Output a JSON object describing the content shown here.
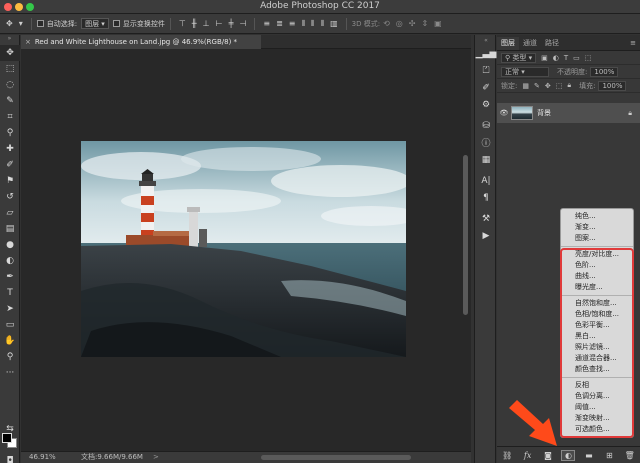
{
  "window": {
    "title": "Adobe Photoshop CC 2017"
  },
  "options_bar": {
    "auto_select_label": "自动选择:",
    "auto_select_value": "图层",
    "show_transform_label": "显示变换控件",
    "mode_3d_label": "3D 模式:"
  },
  "document": {
    "tab_title": "Red and White Lighthouse on Land.jpg @ 46.9%(RGB/8) *",
    "close_glyph": "×"
  },
  "status_bar": {
    "zoom": "46.91%",
    "doc_info": "文档:9.66M/9.66M",
    "arrow": ">"
  },
  "layers_panel": {
    "tabs": [
      "图层",
      "通道",
      "路径"
    ],
    "filter_kind": "类型",
    "blend_mode": "正常",
    "opacity_label": "不透明度:",
    "opacity_value": "100%",
    "lock_label": "锁定:",
    "fill_label": "填充:",
    "fill_value": "100%",
    "layer_name": "背景"
  },
  "adjustment_menu": {
    "group1": [
      "纯色...",
      "渐变...",
      "图案..."
    ],
    "group2": [
      "亮度/对比度...",
      "色阶...",
      "曲线...",
      "曝光度..."
    ],
    "group3": [
      "自然饱和度...",
      "色相/饱和度...",
      "色彩平衡...",
      "黑白...",
      "照片滤镜...",
      "通道混合器...",
      "颜色查找..."
    ],
    "group4": [
      "反相",
      "色调分离...",
      "阈值...",
      "渐变映射...",
      "可选颜色..."
    ]
  },
  "colors": {
    "highlight_border": "#e03a3a",
    "arrow": "#ff4a1a",
    "foreground_swatch": "#000000",
    "background_swatch": "#ffffff"
  },
  "tool_icons": [
    "move-icon",
    "marquee-icon",
    "lasso-icon",
    "quick-select-icon",
    "crop-icon",
    "eyedropper-icon",
    "healing-icon",
    "brush-icon",
    "clone-stamp-icon",
    "history-brush-icon",
    "eraser-icon",
    "gradient-icon",
    "blur-icon",
    "dodge-icon",
    "pen-icon",
    "type-icon",
    "path-select-icon",
    "shape-icon",
    "hand-icon",
    "zoom-icon",
    "more-icon"
  ]
}
